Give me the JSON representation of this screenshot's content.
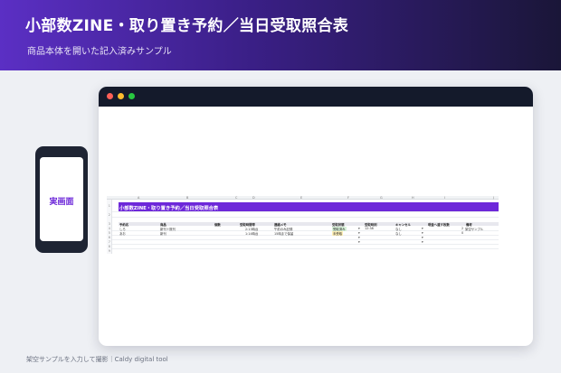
{
  "header": {
    "title": "小部数ZINE・取り置き予約／当日受取照合表",
    "subtitle": "商品本体を開いた記入済みサンプル"
  },
  "phone": {
    "label": "実画面"
  },
  "sheet": {
    "columns": [
      "A",
      "B",
      "C",
      "D",
      "E",
      "F",
      "G",
      "H",
      "I",
      "J"
    ],
    "rows": [
      "1",
      "2",
      "3",
      "4",
      "5",
      "6",
      "7",
      "8",
      "9"
    ],
    "banner": "小部数ZINE・取り置き予約／当日受取照合表",
    "table_headers": [
      "予約名",
      "商品",
      "",
      "個数",
      "受取時間帯",
      "連絡メモ",
      "",
      "受取状態",
      "受取時刻",
      "キャンセル",
      "現金へ渡す枚数",
      "備考"
    ],
    "data_rows": [
      [
        "しろ",
        "新刊＋既刊",
        "",
        "",
        "2:13時台",
        "午前のみ記録",
        "",
        "受取済み",
        "▾",
        "12:38",
        "なし",
        "▾",
        "",
        "2",
        "架空サンプル"
      ],
      [
        "あお",
        "新刊",
        "",
        "",
        "1:14時台",
        "15時まで保留",
        "",
        "未受取",
        "▾",
        "",
        "なし",
        "▾",
        "",
        "0",
        ""
      ]
    ],
    "empty_markers": [
      "▾",
      "▾",
      "▾",
      "▾"
    ],
    "status_colors": {
      "received": "#d8f3d9",
      "pending": "#fff0b8",
      "banner": "#6d28d9"
    }
  },
  "footer": {
    "caption": "架空サンプルを入力して撮影｜Caldy digital tool"
  }
}
